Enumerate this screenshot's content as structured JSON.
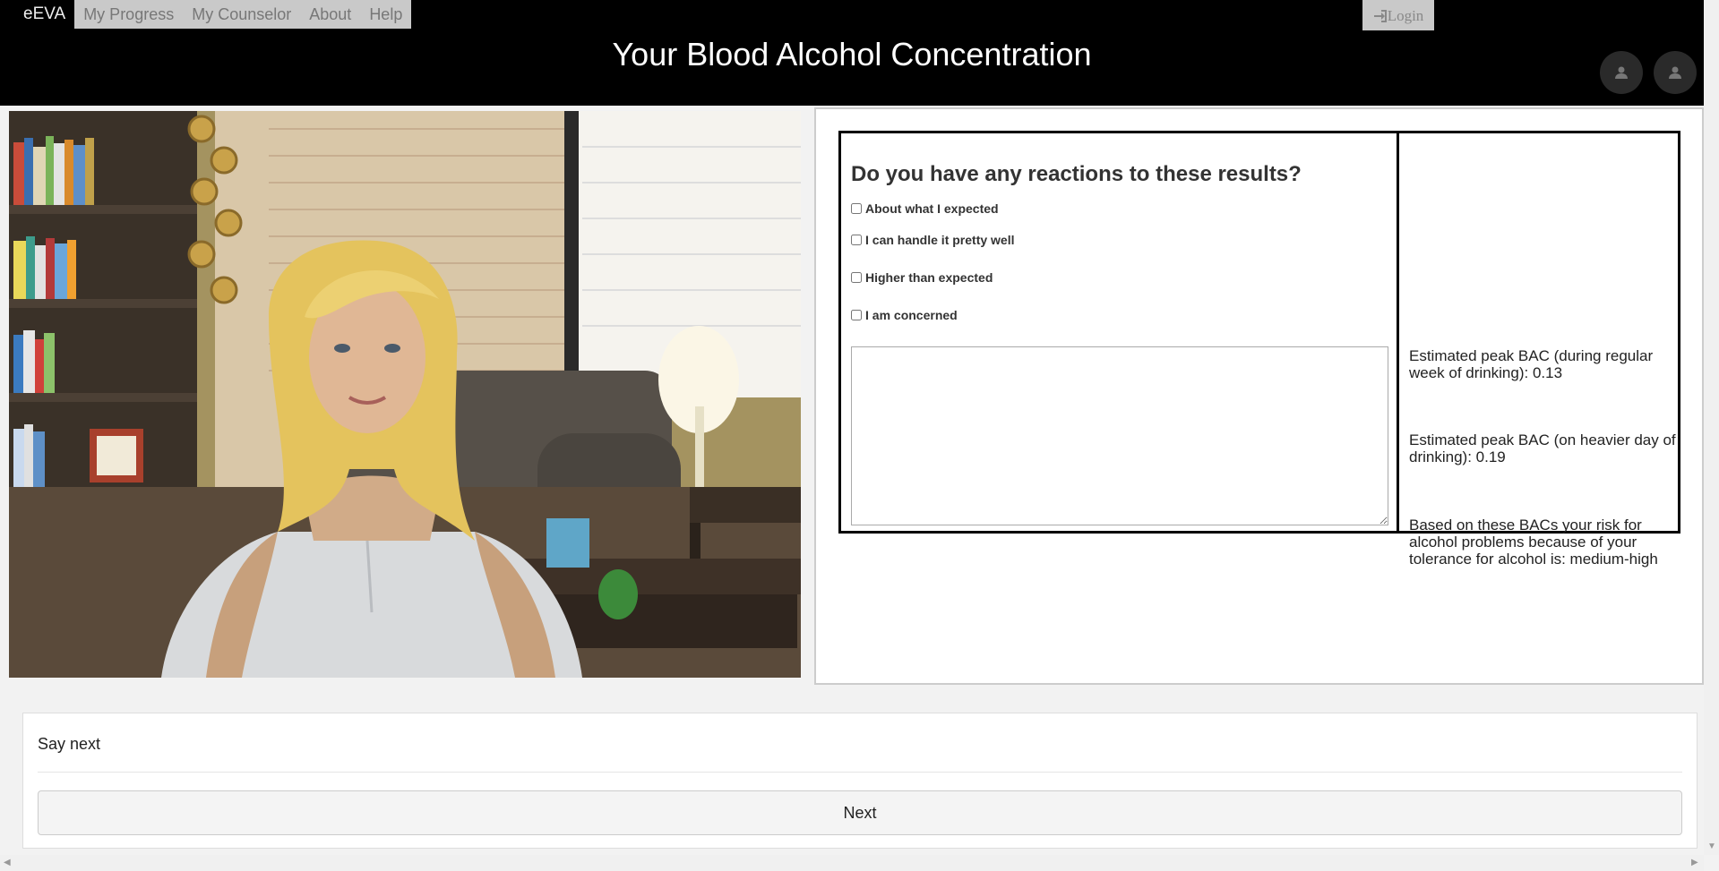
{
  "nav": {
    "brand": "eEVA",
    "links": [
      "My Progress",
      "My Counselor",
      "About",
      "Help"
    ],
    "login": "Login"
  },
  "header": {
    "title": "Your Blood Alcohol Concentration"
  },
  "question": {
    "title": "Do you have any reactions to these results?",
    "options": [
      "About what I expected",
      "I can handle it pretty well",
      "Higher than expected",
      "I am concerned"
    ],
    "response_value": ""
  },
  "results": {
    "peak_regular": "Estimated peak BAC (during regular week of drinking): 0.13",
    "peak_heavier": "Estimated peak BAC (on heavier day of drinking): 0.19",
    "risk": "Based on these BACs your risk for alcohol problems because of your tolerance for alcohol is: medium-high"
  },
  "bottom": {
    "prompt": "Say next",
    "next_label": "Next"
  },
  "icons": [
    "login-icon",
    "user-icon"
  ]
}
